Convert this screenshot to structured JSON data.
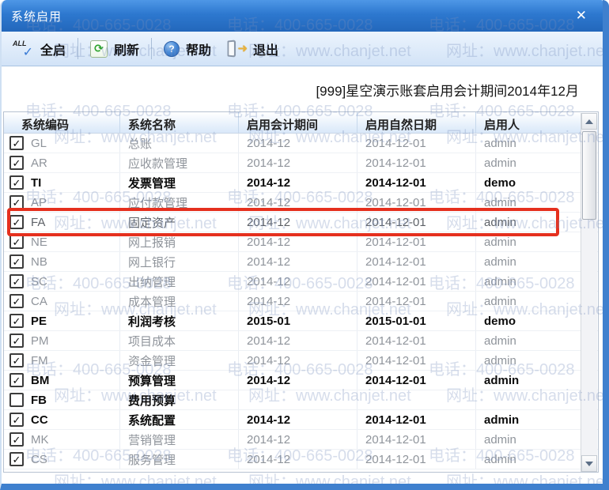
{
  "window": {
    "title": "系统启用",
    "close_glyph": "✕"
  },
  "toolbar": {
    "buttons": [
      {
        "label": "全启",
        "icon": "all-start-icon",
        "glyph": "✓",
        "badge": "ALL"
      },
      {
        "label": "刷新",
        "icon": "refresh-icon",
        "glyph": "⟳"
      },
      {
        "label": "帮助",
        "icon": "help-icon",
        "glyph": "?"
      },
      {
        "label": "退出",
        "icon": "exit-icon",
        "glyph": "➜"
      }
    ]
  },
  "caption": "[999]星空演示账套启用会计期间2014年12月",
  "check_glyph": "✓",
  "table": {
    "columns": [
      "系统编码",
      "系统名称",
      "启用会计期间",
      "启用自然日期",
      "启用人"
    ],
    "rows": [
      {
        "checked": true,
        "code": "GL",
        "name": "总账",
        "period": "2014-12",
        "date": "2014-12-01",
        "user": "admin",
        "style": "dim"
      },
      {
        "checked": true,
        "code": "AR",
        "name": "应收款管理",
        "period": "2014-12",
        "date": "2014-12-01",
        "user": "admin",
        "style": "dim"
      },
      {
        "checked": true,
        "code": "TI",
        "name": "发票管理",
        "period": "2014-12",
        "date": "2014-12-01",
        "user": "demo",
        "style": "bold"
      },
      {
        "checked": true,
        "code": "AP",
        "name": "应付款管理",
        "period": "2014-12",
        "date": "2014-12-01",
        "user": "admin",
        "style": "dim"
      },
      {
        "checked": true,
        "code": "FA",
        "name": "固定资产",
        "period": "2014-12",
        "date": "2014-12-01",
        "user": "admin",
        "style": "selected"
      },
      {
        "checked": true,
        "code": "NE",
        "name": "网上报销",
        "period": "2014-12",
        "date": "2014-12-01",
        "user": "admin",
        "style": "dim"
      },
      {
        "checked": true,
        "code": "NB",
        "name": "网上银行",
        "period": "2014-12",
        "date": "2014-12-01",
        "user": "admin",
        "style": "dim"
      },
      {
        "checked": true,
        "code": "SC",
        "name": "出纳管理",
        "period": "2014-12",
        "date": "2014-12-01",
        "user": "admin",
        "style": "dim"
      },
      {
        "checked": true,
        "code": "CA",
        "name": "成本管理",
        "period": "2014-12",
        "date": "2014-12-01",
        "user": "admin",
        "style": "dim"
      },
      {
        "checked": true,
        "code": "PE",
        "name": "利润考核",
        "period": "2015-01",
        "date": "2015-01-01",
        "user": "demo",
        "style": "bold"
      },
      {
        "checked": true,
        "code": "PM",
        "name": "项目成本",
        "period": "2014-12",
        "date": "2014-12-01",
        "user": "admin",
        "style": "dim"
      },
      {
        "checked": true,
        "code": "FM",
        "name": "资金管理",
        "period": "2014-12",
        "date": "2014-12-01",
        "user": "admin",
        "style": "dim"
      },
      {
        "checked": true,
        "code": "BM",
        "name": "预算管理",
        "period": "2014-12",
        "date": "2014-12-01",
        "user": "admin",
        "style": "bold"
      },
      {
        "checked": false,
        "code": "FB",
        "name": "费用预算",
        "period": "",
        "date": "",
        "user": "",
        "style": "bold"
      },
      {
        "checked": true,
        "code": "CC",
        "name": "系统配置",
        "period": "2014-12",
        "date": "2014-12-01",
        "user": "admin",
        "style": "bold"
      },
      {
        "checked": true,
        "code": "MK",
        "name": "营销管理",
        "period": "2014-12",
        "date": "2014-12-01",
        "user": "admin",
        "style": "dim"
      },
      {
        "checked": true,
        "code": "CS",
        "name": "服务管理",
        "period": "2014-12",
        "date": "2014-12-01",
        "user": "admin",
        "style": "dim"
      }
    ],
    "highlighted_code": "FA"
  },
  "watermark": {
    "phone": "电话：400-665-0028",
    "url": "网址：www.chanjet.net"
  },
  "colors": {
    "titlebar_blue": "#2d78cf",
    "dialog_border_blue": "#3f80ce",
    "highlight_red": "#e5301e",
    "dim_text": "#8f949b"
  }
}
